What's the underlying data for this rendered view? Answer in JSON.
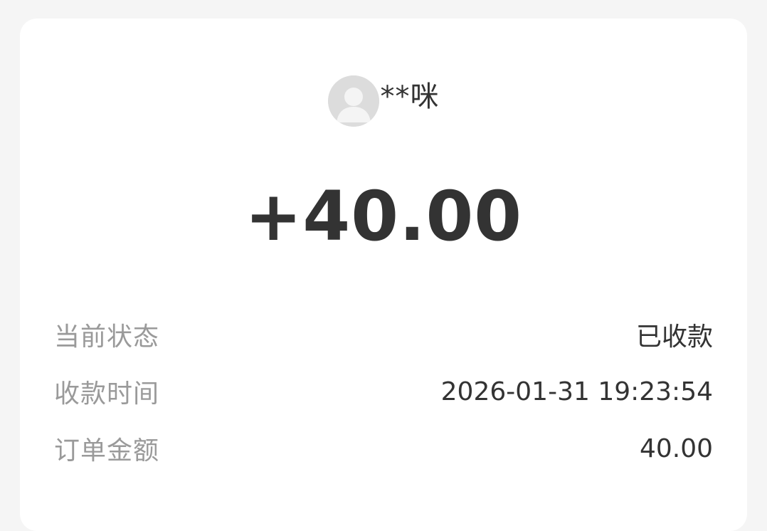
{
  "payer": {
    "name": "**咪",
    "avatar_icon": "default-user-avatar-icon"
  },
  "transaction": {
    "amount": "+40.00"
  },
  "details": [
    {
      "label": "当前状态",
      "value": "已收款"
    },
    {
      "label": "收款时间",
      "value": "2026-01-31 19:23:54"
    },
    {
      "label": "订单金额",
      "value": "40.00"
    }
  ],
  "colors": {
    "background": "#f5f5f5",
    "card": "#ffffff",
    "primary_text": "#333333",
    "secondary_text": "#9a9a9a",
    "avatar_bg": "#dcdcdc"
  }
}
